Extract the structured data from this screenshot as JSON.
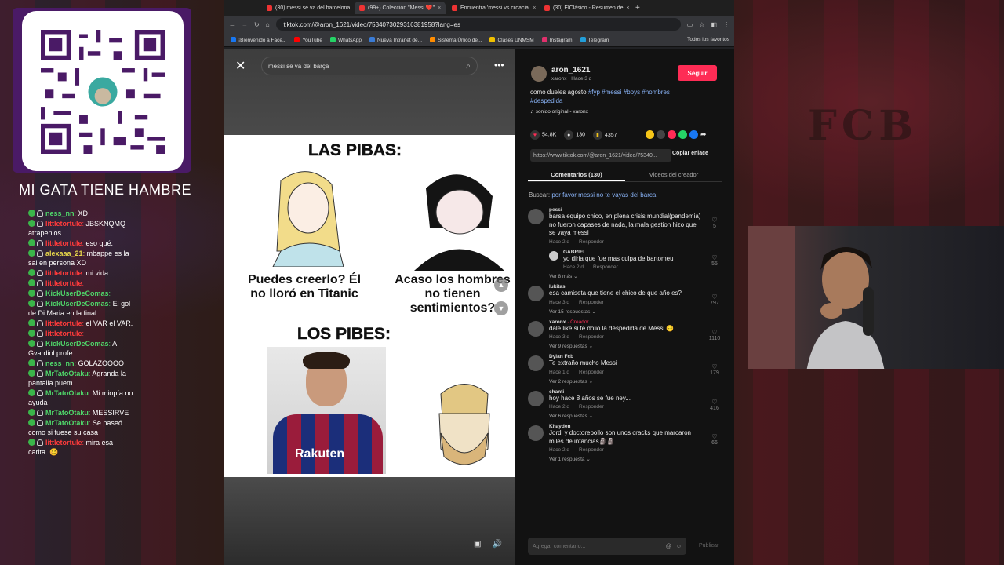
{
  "overlay": {
    "title": "MI GATA TIENE HAMBRE",
    "background_text": "FCB"
  },
  "chat": [
    {
      "user": "ness_nn",
      "text": "XD",
      "color": "#4fd86a",
      "badge": "13"
    },
    {
      "user": "littletortule",
      "text": "JBSKNQMQ atrapenlos.",
      "color": "#ff3b3b"
    },
    {
      "user": "littletortule",
      "text": "eso qué.",
      "color": "#ff3b3b"
    },
    {
      "user": "alexaaa_21",
      "text": "mbappe es la sal en persona XD",
      "color": "#e8d84a"
    },
    {
      "user": "littletortule",
      "text": "mi vida.",
      "color": "#ff3b3b"
    },
    {
      "user": "littletortule",
      "text": "",
      "color": "#ff3b3b"
    },
    {
      "user": "KickUserDeComas",
      "text": "",
      "color": "#4fd86a"
    },
    {
      "user": "KickUserDeComas",
      "text": "El gol de Di Maria en la final",
      "color": "#4fd86a"
    },
    {
      "user": "littletortule",
      "text": "el VAR el VAR.",
      "color": "#ff3b3b"
    },
    {
      "user": "littletortule",
      "text": "",
      "color": "#ff3b3b"
    },
    {
      "user": "KickUserDeComas",
      "text": "A Gvardiol profe",
      "color": "#4fd86a"
    },
    {
      "user": "ness_nn",
      "text": "GOLAZOOOO",
      "color": "#4fd86a"
    },
    {
      "user": "MrTatoOtaku",
      "text": "Agranda la pantalla puem",
      "color": "#4fd86a"
    },
    {
      "user": "MrTatoOtaku",
      "text": "Mi miopía no ayuda",
      "color": "#4fd86a"
    },
    {
      "user": "MrTatoOtaku",
      "text": "MESSIRVE",
      "color": "#4fd86a"
    },
    {
      "user": "MrTatoOtaku",
      "text": "Se paseó como si fuese su casa",
      "color": "#4fd86a"
    },
    {
      "user": "littletortule",
      "text": "mira esa carita. 😊",
      "color": "#ff3b3b"
    }
  ],
  "browser": {
    "tabs": [
      {
        "label": "(30) messi se va del barcelona",
        "active": false
      },
      {
        "label": "(99+) Colección \"Messi ❤️\"",
        "active": true
      },
      {
        "label": "Encuentra 'messi vs croacia'",
        "active": false
      },
      {
        "label": "(30) ElClásico - Resumen de",
        "active": false
      }
    ],
    "url": "tiktok.com/@aron_1621/video/7534073029316381958?lang=es",
    "bookmarks": [
      "¡Bienvenido a Face...",
      "YouTube",
      "WhatsApp",
      "Nueva Intranet de...",
      "Sistema Único de...",
      "Clases UNMSM",
      "Instagram",
      "Telegram"
    ],
    "all_bookmarks": "Todos los favoritos"
  },
  "video": {
    "search_value": "messi se va del barça",
    "meme_top": "LAS PIBAS:",
    "caption_left": "Puedes creerlo? Él no lloró en Titanic",
    "caption_right": "Acaso los hombres no tienen sentimientos?",
    "meme_bottom": "LOS PIBES:",
    "shirt_text": "Rakuten"
  },
  "post": {
    "username": "aron_1621",
    "subtitle": "xaronx · Hace 3 d",
    "follow": "Seguir",
    "desc_text": "como dueles agosto",
    "tags": "#fyp #messi #boys #hombres #despedida",
    "sound": "sonido original - xaronx",
    "likes": "54.8K",
    "comments": "130",
    "saves": "4357",
    "link": "https://www.tiktok.com/@aron_1621/video/75340...",
    "copy": "Copiar enlace",
    "tab_comments": "Comentarios (130)",
    "tab_videos": "Videos del creador",
    "buscar_label": "Buscar:",
    "buscar_query": "por favor messi no te vayas del barca",
    "add_placeholder": "Agregar comentario...",
    "publicar": "Publicar"
  },
  "comments": [
    {
      "name": "pessi",
      "creator": "",
      "text": "barsa equipo chico, en plena crisis mundial(pandemia) no fueron capases de nada, la mala gestion hizo que se vaya messi",
      "time": "Hace 2 d",
      "reply": "Responder",
      "likes": "5",
      "sub": {
        "name": "GABRIEL",
        "text": "yo diria que fue mas culpa de bartomeu",
        "time": "Hace 2 d",
        "likes": "55"
      },
      "more": "Ver 8 más"
    },
    {
      "name": "lukitas",
      "creator": "",
      "text": "esa camiseta que tiene el chico de que año es?",
      "time": "Hace 3 d",
      "reply": "Responder",
      "likes": "797",
      "more": "Ver 15 respuestas"
    },
    {
      "name": "xaronx",
      "creator": "· Creador",
      "text": "dale like si te dolió la despedida de Messi 😔",
      "time": "Hace 3 d",
      "reply": "Responder",
      "likes": "1110",
      "more": "Ver 9 respuestas"
    },
    {
      "name": "Dylan Fcb",
      "creator": "",
      "text": "Te extraño mucho Messi",
      "time": "Hace 1 d",
      "reply": "Responder",
      "likes": "179",
      "more": "Ver 2 respuestas"
    },
    {
      "name": "chanti",
      "creator": "",
      "text": "hoy hace 8 años se fue ney...",
      "time": "Hace 2 d",
      "reply": "Responder",
      "likes": "416",
      "more": "Ver 6 respuestas"
    },
    {
      "name": "Khayden",
      "creator": "",
      "text": "Jordi y doctorepollo son unos cracks que marcaron miles de infancias🗿🗿",
      "time": "Hace 2 d",
      "reply": "Responder",
      "likes": "66",
      "more": "Ver 1 respuesta"
    }
  ]
}
